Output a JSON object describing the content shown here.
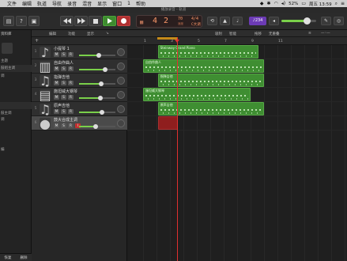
{
  "menubar": {
    "items": [
      "文件",
      "编辑",
      "轨道",
      "导航",
      "录音",
      "混音",
      "显示",
      "窗口",
      "1",
      "帮助"
    ],
    "battery": "52%",
    "clock": "周五 13:59"
  },
  "window": {
    "title": "播放录音 - 轨道"
  },
  "controlbar": {
    "lcd_bar": "4",
    "lcd_beat": "2",
    "tempo": "70",
    "tempo_label": "速度",
    "time_signature": "4/4",
    "key": "C大调",
    "count_in": "♪234",
    "metronome_glyph": "▲",
    "tuner_glyph": "♩",
    "master_volume_fraction": 0.72
  },
  "library": {
    "title": "资料库",
    "items": [
      "主题",
      "鼓组主调",
      "调"
    ],
    "lower_items": [
      "鼓主调",
      "调",
      "编"
    ],
    "bottom_labels": [
      "恢复",
      "删除"
    ]
  },
  "tracks_toolbar": {
    "edit": "编辑",
    "functions": "功能",
    "view": "显示",
    "snap": "吸附",
    "snap_value": "智能",
    "drag": "拖移",
    "drag_value": "无重叠"
  },
  "ruler": {
    "ticks": [
      "1",
      "3",
      "5",
      "7",
      "9",
      "11"
    ]
  },
  "tracks": [
    {
      "num": "1",
      "name": "小提琴 1",
      "fader": 0.55,
      "color": "#3f8e32",
      "icon": "violin-icon",
      "selected": false
    },
    {
      "num": "2",
      "name": "自由作曲人",
      "fader": 0.72,
      "color": "#3f8e32",
      "icon": "keyboard-icon",
      "selected": false
    },
    {
      "num": "3",
      "name": "指弹吉他",
      "fader": 0.6,
      "color": "#3f8e32",
      "icon": "guitar-icon",
      "selected": false
    },
    {
      "num": "4",
      "name": "施坦威大钢琴",
      "fader": 0.58,
      "color": "#3f8e32",
      "icon": "piano-icon",
      "selected": false
    },
    {
      "num": "5",
      "name": "原声吉他",
      "fader": 0.62,
      "color": "#3f8e32",
      "icon": "guitar-icon",
      "selected": false
    },
    {
      "num": "6",
      "name": "鼓大合成主调",
      "fader": 0.45,
      "color": "#8f1e1e",
      "icon": "mic-icon",
      "selected": true
    }
  ],
  "regions": [
    {
      "track": 0,
      "label": "Steinway Grand Piano",
      "start_bar": 2.1,
      "end_bar": 9.6,
      "kind": "midi"
    },
    {
      "track": 1,
      "label": "自由作曲人",
      "start_bar": 1.0,
      "end_bar": 10.0,
      "kind": "midi"
    },
    {
      "track": 2,
      "label": "指弹吉他",
      "start_bar": 2.1,
      "end_bar": 10.0,
      "kind": "midi"
    },
    {
      "track": 3,
      "label": "施坦威大钢琴",
      "start_bar": 1.0,
      "end_bar": 9.0,
      "kind": "midi"
    },
    {
      "track": 4,
      "label": "原声吉他",
      "start_bar": 2.1,
      "end_bar": 10.0,
      "kind": "midi"
    },
    {
      "track": 5,
      "label": "",
      "start_bar": 2.1,
      "end_bar": 3.6,
      "kind": "audio"
    }
  ]
}
